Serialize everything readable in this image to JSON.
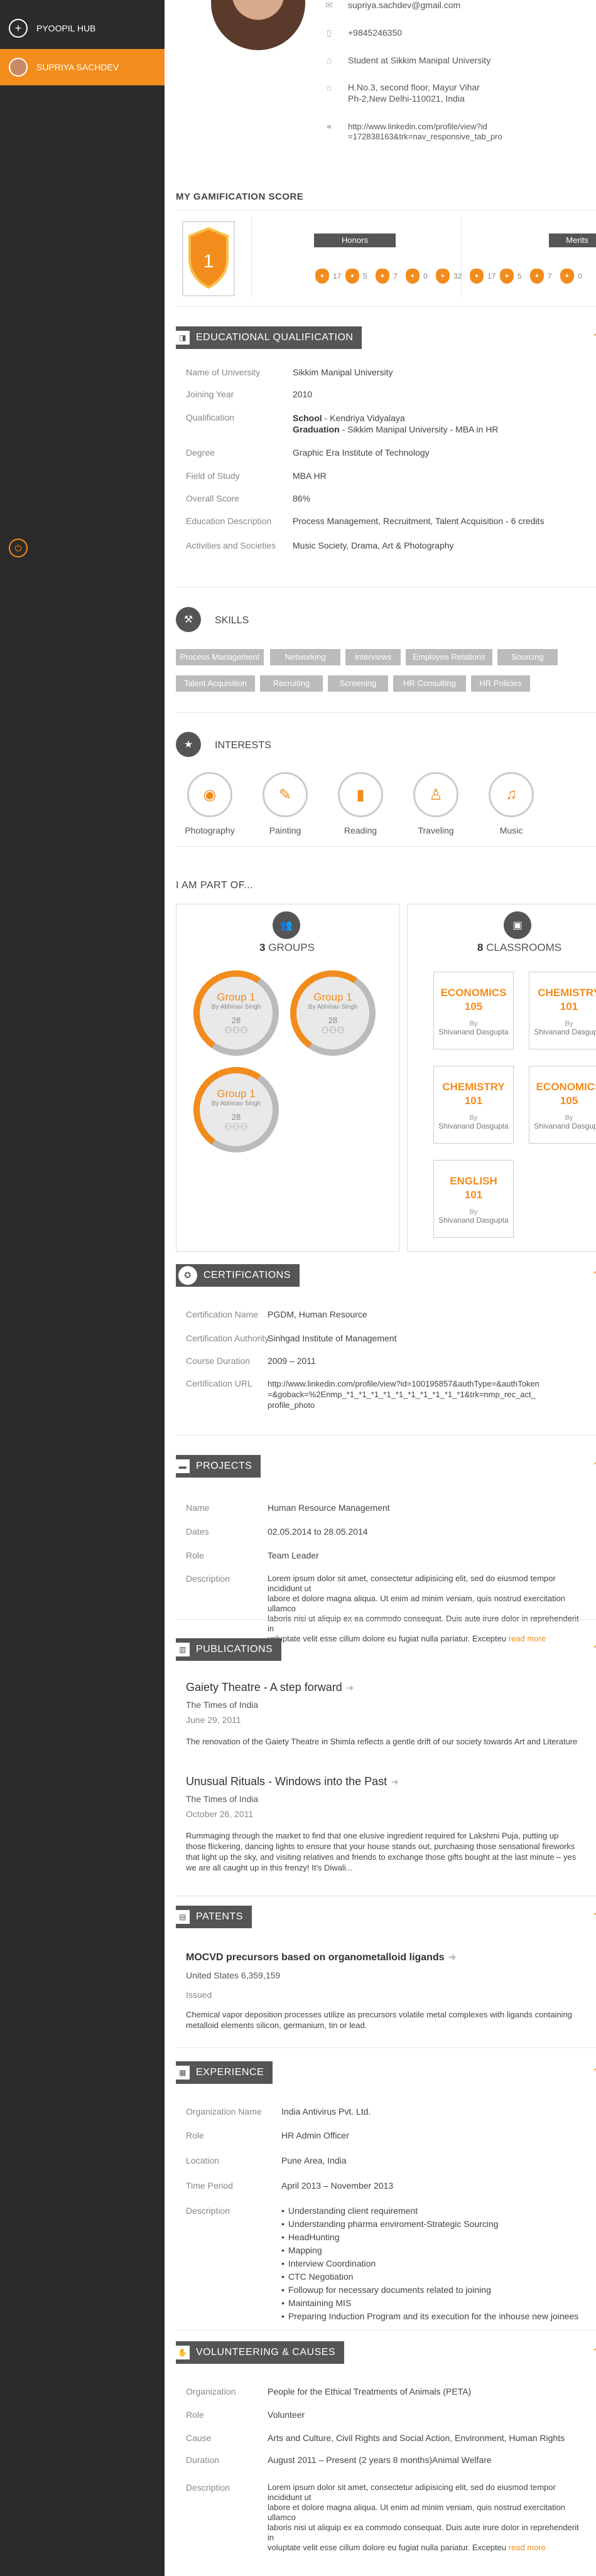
{
  "sidebar": {
    "hub_label": "PYOOPIL HUB",
    "user_label": "SUPRIYA SACHDEV",
    "hub_icon": "plus-icon",
    "power_icon": "power-icon"
  },
  "contact": {
    "email": "supriya.sachdev@gmail.com",
    "phone": "+9845246350",
    "education": "Student at Sikkim Manipal University",
    "address_line1": "H.No.3, second floor, Mayur Vihar",
    "address_line2": "Ph-2,New Delhi-110021, India",
    "linkedin_line1": "http://www.linkedin.com/profile/view?id",
    "linkedin_line2": "=172838163&trk=nav_responsive_tab_pro"
  },
  "gamification": {
    "title": "MY GAMIFICATION SCORE",
    "level": "1",
    "honors_label": "Honors",
    "merits_label": "Merits",
    "honors": [
      "17",
      "5",
      "7",
      "0",
      "32"
    ],
    "merits": [
      "17",
      "5",
      "7",
      "0"
    ]
  },
  "education": {
    "title": "EDUCATIONAL QUALIFICATION",
    "rows": [
      {
        "k": "Name of University",
        "v": "Sikkim Manipal University"
      },
      {
        "k": "Joining Year",
        "v": "2010"
      }
    ],
    "qualification_label": "Qualification",
    "school_label": "School",
    "school_value": " - Kendriya Vidyalaya",
    "graduation_label": "Graduation",
    "graduation_value": " - Sikkim Manipal University - MBA in HR",
    "rows2": [
      {
        "k": "Degree",
        "v": "Graphic Era Institute of Technology"
      },
      {
        "k": "Field of Study",
        "v": "MBA HR"
      },
      {
        "k": "Overall Score",
        "v": "86%"
      },
      {
        "k": "Education Description",
        "v": "Process Management, Recruitment, Talent Acquisition - 6 credits"
      },
      {
        "k": "Activities and Societies",
        "v": "Music Society, Drama, Art & Photography"
      }
    ]
  },
  "skills": {
    "title": "SKILLS",
    "items": [
      "Process Management",
      "Networking",
      "Interviews",
      "Employee Relations",
      "Sourcing",
      "Talent Acquisition",
      "Recruiting",
      "Screening",
      "HR Consulting",
      "HR Policies"
    ]
  },
  "interests": {
    "title": "INTERESTS",
    "items": [
      "Photography",
      "Painting",
      "Reading",
      "Traveling",
      "Music"
    ]
  },
  "part_of": {
    "title": "I AM PART OF...",
    "groups_count": "3",
    "groups_label": "GROUPS",
    "classrooms_count": "8",
    "classrooms_label": "CLASSROOMS",
    "groups": [
      {
        "name": "Group 1",
        "by": "By Abhinav Singh",
        "num": "28"
      },
      {
        "name": "Group 1",
        "by": "By Abhinav Singh",
        "num": "28"
      },
      {
        "name": "Group 1",
        "by": "By Abhinav Singh",
        "num": "28"
      }
    ],
    "classrooms": [
      {
        "name": "ECONOMICS",
        "num": "105",
        "by": "By",
        "teacher": "Shivanand Dasgupta"
      },
      {
        "name": "CHEMISTRY",
        "num": "101",
        "by": "By",
        "teacher": "Shivanand Dasgupta"
      },
      {
        "name": "CHEMISTRY",
        "num": "101",
        "by": "By",
        "teacher": "Shivanand Dasgupta"
      },
      {
        "name": "ECONOMICS",
        "num": "105",
        "by": "By",
        "teacher": "Shivanand Dasgupta"
      },
      {
        "name": "ENGLISH",
        "num": "101",
        "by": "By",
        "teacher": "Shivanand Dasgupta"
      }
    ]
  },
  "certifications": {
    "title": "CERTIFICATIONS",
    "rows": [
      {
        "k": "Certification Name",
        "v": "PGDM, Human Resource"
      },
      {
        "k": "Certification Authority",
        "v": "Sinhgad Institute of Management"
      },
      {
        "k": "Course Duration",
        "v": "2009 – 2011"
      }
    ],
    "url_label": "Certification URL",
    "url_line1": "http://www.linkedin.com/profile/view?id=100195857&authType=&authToken",
    "url_line2": "=&goback=%2Enmp_*1_*1_*1_*1_*1_*1_*1_*1_*1_*1&trk=nmp_rec_act_",
    "url_line3": "profile_photo"
  },
  "projects": {
    "title": "PROJECTS",
    "rows": [
      {
        "k": "Name",
        "v": "Human Resource Management"
      },
      {
        "k": "Dates",
        "v": "02.05.2014 to 28.05.2014"
      },
      {
        "k": "Role",
        "v": "Team Leader"
      }
    ],
    "desc_label": "Description",
    "desc_line1": "Lorem ipsum dolor sit amet, consectetur adipisicing elit, sed do eiusmod tempor incididunt ut",
    "desc_line2": "labore et dolore magna aliqua. Ut enim ad minim veniam, quis nostrud exercitation ullamco",
    "desc_line3": "laboris nisi ut aliquip ex ea commodo consequat. Duis aute irure dolor in reprehenderit in",
    "desc_line4": "voluptate velit esse cillum dolore eu fugiat nulla pariatur. Excepteu",
    "read_more": "read more"
  },
  "publications": {
    "title": "PUBLICATIONS",
    "items": [
      {
        "title": "Gaiety Theatre - A step forward",
        "source": "The Times of India",
        "date": "June 29, 2011",
        "text1": "The renovation of the Gaiety Theatre in Shimla reflects a gentle drift of our society towards Art and Literature",
        "text2": "",
        "text3": "",
        "text4": ""
      },
      {
        "title": "Unusual Rituals - Windows into the Past",
        "source": "The Times of India",
        "date": "October 26, 2011",
        "text1": "Rummaging through the market to find that one elusive ingredient required for Lakshmi Puja, putting up",
        "text2": "those flickering, dancing lights to ensure that your house stands out, purchasing those sensational fireworks",
        "text3": "that light up the sky, and visiting relatives and friends to exchange those gifts bought at the last minute – yes",
        "text4": "we are all caught up in this frenzy! It's Diwali..."
      }
    ]
  },
  "patents": {
    "title": "PATENTS",
    "name": "MOCVD precursors based on organometalloid ligands",
    "number": "United States 6,359,159",
    "status": "Issued",
    "text1": "Chemical vapor deposition processes utilize as precursors volatile metal complexes with ligands containing",
    "text2": "metalloid elements silicon, germanium, tin or lead."
  },
  "experience": {
    "title": "EXPERIENCE",
    "rows": [
      {
        "k": "Organization Name",
        "v": "India Antivirus Pvt. Ltd."
      },
      {
        "k": "Role",
        "v": "HR Admin Officer"
      },
      {
        "k": "Location",
        "v": "Pune Area, India"
      },
      {
        "k": "Time Period",
        "v": "April 2013 – November 2013"
      }
    ],
    "desc_label": "Description",
    "bullets": [
      "Understanding client requirement",
      "Understanding pharma enviroment-Strategic Sourcing",
      "HeadHunting",
      "Mapping",
      "Interview Coordination",
      "CTC Negotiation",
      "Followup for necessary documents related to joining",
      "Maintaining MIS",
      "Preparing Induction Program and its execution for the inhouse new joinees"
    ]
  },
  "volunteering": {
    "title": "VOLUNTEERING & CAUSES",
    "rows": [
      {
        "k": "Organization",
        "v": "People for the Ethical Treatments of Animals (PETA)"
      },
      {
        "k": "Role",
        "v": "Volunteer"
      },
      {
        "k": "Cause",
        "v": "Arts and Culture, Civil Rights and Social Action, Environment, Human Rights"
      },
      {
        "k": "Duration",
        "v": "August 2011 – Present (2 years 8 months)Animal Welfare"
      }
    ],
    "desc_label": "Description",
    "desc_line1": "Lorem ipsum dolor sit amet, consectetur adipisicing elit, sed do eiusmod tempor incididunt ut",
    "desc_line2": "labore et dolore magna aliqua. Ut enim ad minim veniam, quis nostrud exercitation ullamco",
    "desc_line3": "laboris nisi ut aliquip ex ea commodo consequat. Duis aute irure dolor in reprehenderit in",
    "desc_line4": "voluptate velit esse cillum dolore eu fugiat nulla pariatur. Excepteu",
    "read_more": "read more"
  },
  "colors": {
    "accent": "#f28c1c",
    "sidebar": "#2b2b2b",
    "header": "#555555"
  }
}
